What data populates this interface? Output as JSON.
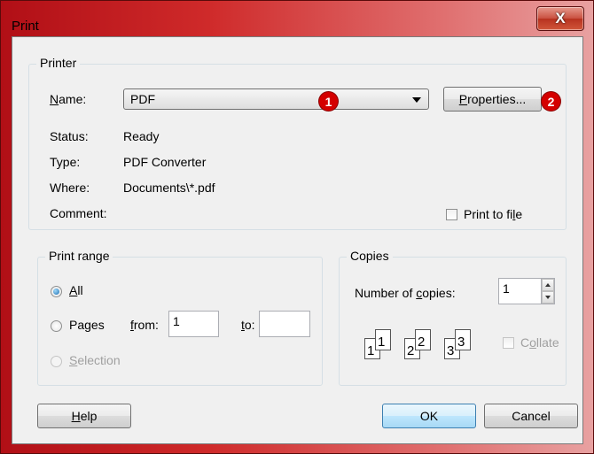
{
  "window": {
    "title": "Print",
    "close_glyph": "X"
  },
  "printer": {
    "group_label": "Printer",
    "name_label": "Name:",
    "name_value": "PDF",
    "properties_label": "Properties...",
    "status_label": "Status:",
    "status_value": "Ready",
    "type_label": "Type:",
    "type_value": "PDF Converter",
    "where_label": "Where:",
    "where_value": "Documents\\*.pdf",
    "comment_label": "Comment:",
    "comment_value": "",
    "print_to_file_label": "Print to file",
    "print_to_file_checked": false
  },
  "callouts": {
    "one": "1",
    "two": "2"
  },
  "print_range": {
    "group_label": "Print range",
    "all_label": "All",
    "pages_label": "Pages",
    "from_label": "from:",
    "from_value": "1",
    "to_label": "to:",
    "to_value": "",
    "selection_label": "Selection",
    "selected": "All"
  },
  "copies": {
    "group_label": "Copies",
    "number_label": "Number of copies:",
    "number_value": "1",
    "collate_label": "Collate",
    "collate_checked": false,
    "collate_pages": [
      "1",
      "1",
      "2",
      "2",
      "3",
      "3"
    ]
  },
  "buttons": {
    "help": "Help",
    "ok": "OK",
    "cancel": "Cancel"
  },
  "colors": {
    "title_gradient_start": "#b10f16",
    "badge_red": "#d40000",
    "default_button": "#3c7fb1"
  }
}
